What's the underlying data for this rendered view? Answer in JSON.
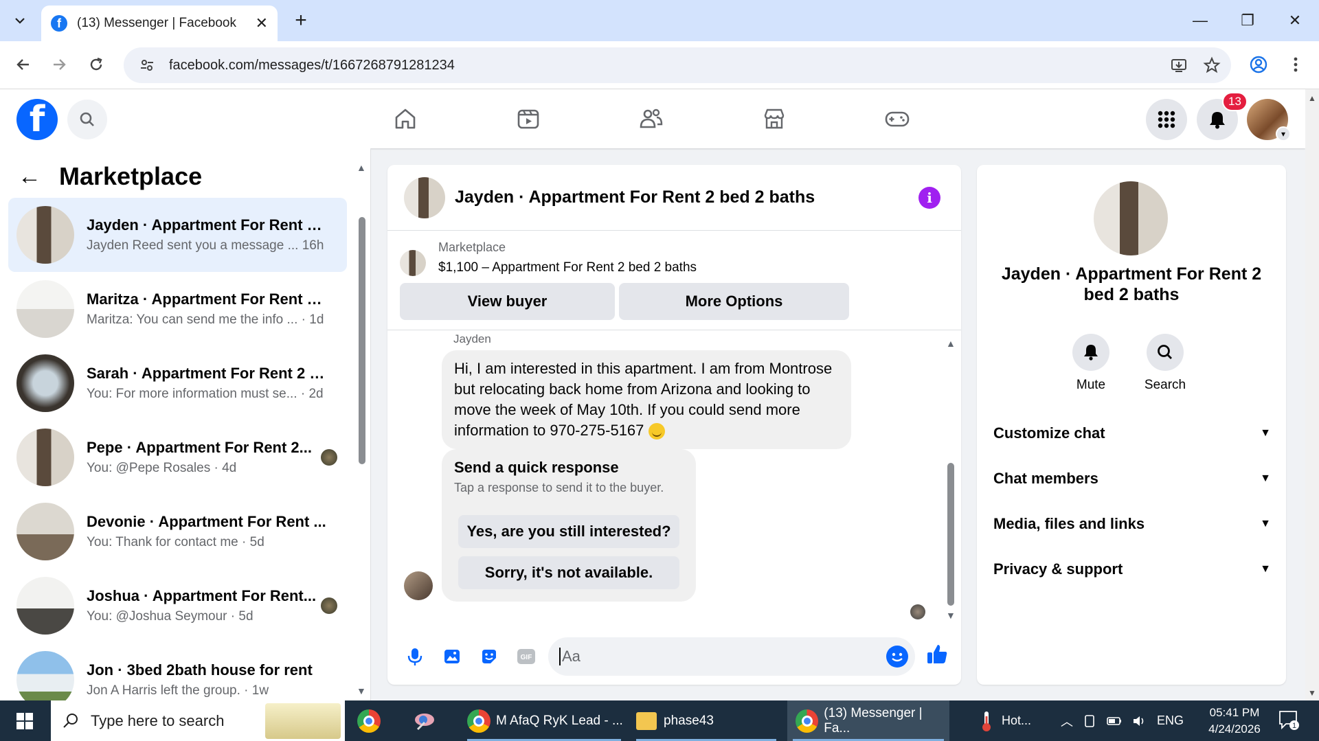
{
  "browser": {
    "tab_title": "(13) Messenger | Facebook",
    "tab_close": "✕",
    "new_tab": "+",
    "url": "facebook.com/messages/t/1667268791281234",
    "window_controls": {
      "minimize": "—",
      "restore": "❐",
      "close": "✕"
    }
  },
  "fb_header": {
    "logo": "f",
    "notification_count": "13",
    "icons": [
      "search-icon",
      "home-icon",
      "video-icon",
      "friends-icon",
      "marketplace-icon",
      "gaming-icon",
      "menu-grid-icon",
      "bell-icon",
      "profile-avatar"
    ]
  },
  "sidebar": {
    "title": "Marketplace",
    "back": "←",
    "conversations": [
      {
        "name": "Jayden · Appartment For Rent 2 ...",
        "preview": "Jayden Reed sent you a message ...",
        "time": "16h",
        "active": true
      },
      {
        "name": "Maritza · Appartment For Rent 2...",
        "preview": "Maritza: You can send me the info ...",
        "time": "1d"
      },
      {
        "name": "Sarah · Appartment For Rent 2 b...",
        "preview": "You: For more information must se...",
        "time": "2d"
      },
      {
        "name": "Pepe · Appartment For Rent 2...",
        "preview": "You: @Pepe Rosales",
        "time": "4d"
      },
      {
        "name": "Devonie · Appartment For Rent ...",
        "preview": "You: Thank for contact me",
        "time": "5d"
      },
      {
        "name": "Joshua · Appartment For Rent...",
        "preview": "You: @Joshua Seymour",
        "time": "5d"
      },
      {
        "name": "Jon · 3bed 2bath house for rent",
        "preview": "Jon A Harris left the group.",
        "time": "1w"
      }
    ]
  },
  "chat": {
    "title": "Jayden · Appartment For Rent 2 bed 2 baths",
    "listing_source": "Marketplace",
    "listing_detail": "$1,100 – Appartment For Rent 2 bed 2 baths",
    "view_buyer": "View buyer",
    "more_options": "More Options",
    "sender": "Jayden",
    "message": "Hi, I am interested in this apartment. I am from Montrose but relocating back home from Arizona and looking to move the week of May 10th. If you could send more information to 970-275-5167",
    "quick_title": "Send a quick response",
    "quick_sub": "Tap a response to send it to the buyer.",
    "quick_1": "Yes, are you still interested?",
    "quick_2": "Sorry, it's not available.",
    "input_placeholder": "Aa",
    "gif_label": "GIF"
  },
  "info_panel": {
    "name": "Jayden · Appartment For Rent 2 bed 2 baths",
    "mute": "Mute",
    "search": "Search",
    "sections": [
      "Customize chat",
      "Chat members",
      "Media, files and links",
      "Privacy & support"
    ]
  },
  "taskbar": {
    "search_placeholder": "Type here to search",
    "app1": "M AfaQ RyK Lead - ...",
    "app2": "phase43",
    "app3": "(13) Messenger | Fa...",
    "weather": "Hot...",
    "lang": "ENG",
    "time": "05:41 PM",
    "date": "4/24/2026",
    "notif_count": "1"
  },
  "colors": {
    "fb_blue": "#0866ff",
    "badge_red": "#e41e3f",
    "info_purple": "#a020f0",
    "active_row": "#e7f0fd",
    "taskbar": "#1c2e3f"
  }
}
